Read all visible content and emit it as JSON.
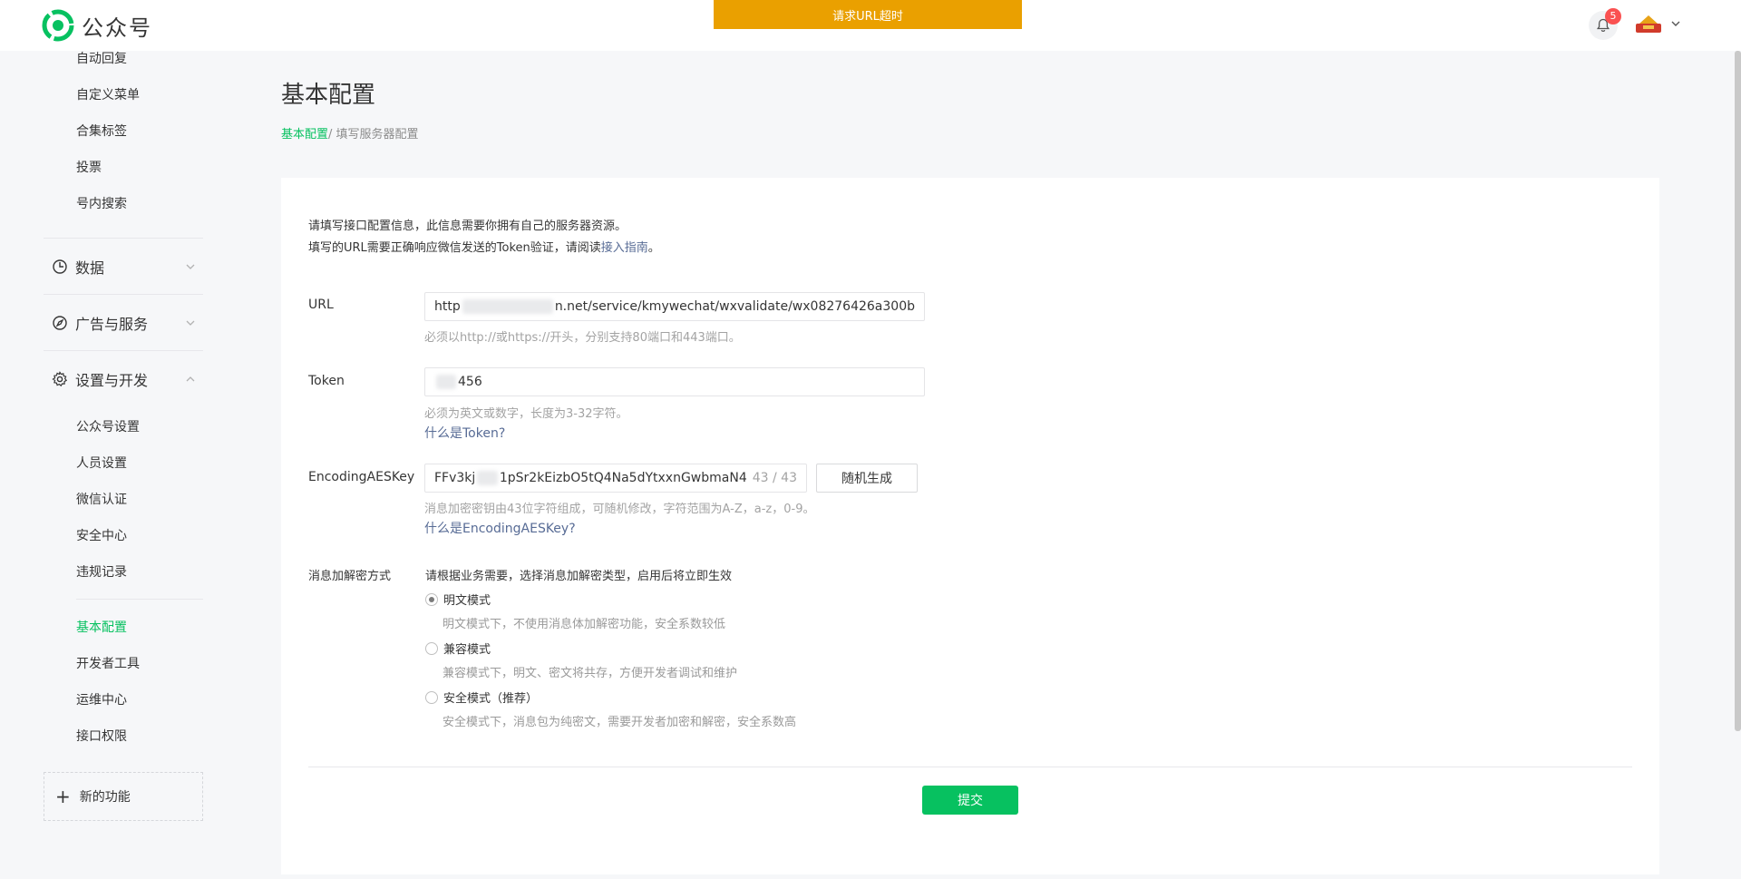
{
  "header": {
    "brand": "公众号",
    "toast": "请求URL超时",
    "notification_count": "5"
  },
  "sidebar": {
    "top_items": [
      {
        "label": "自动回复"
      },
      {
        "label": "自定义菜单"
      },
      {
        "label": "合集标签"
      },
      {
        "label": "投票"
      },
      {
        "label": "号内搜索"
      }
    ],
    "groups": [
      {
        "label": "数据",
        "icon": "chart-icon",
        "expanded": false
      },
      {
        "label": "广告与服务",
        "icon": "compass-icon",
        "expanded": false
      },
      {
        "label": "设置与开发",
        "icon": "gear-icon",
        "expanded": true
      }
    ],
    "settings_items": [
      {
        "label": "公众号设置"
      },
      {
        "label": "人员设置"
      },
      {
        "label": "微信认证"
      },
      {
        "label": "安全中心"
      },
      {
        "label": "违规记录"
      }
    ],
    "dev_items": [
      {
        "label": "基本配置",
        "active": true
      },
      {
        "label": "开发者工具"
      },
      {
        "label": "运维中心"
      },
      {
        "label": "接口权限"
      }
    ],
    "new_function": "新的功能"
  },
  "main": {
    "title": "基本配置",
    "breadcrumb": {
      "link": "基本配置",
      "sep": "/ ",
      "current": "填写服务器配置"
    },
    "intro_line1": "请填写接口配置信息，此信息需要你拥有自己的服务器资源。",
    "intro_line2_prefix": "填写的URL需要正确响应微信发送的Token验证，请阅读",
    "intro_line2_link": "接入指南",
    "intro_line2_suffix": "。",
    "url": {
      "label": "URL",
      "value_prefix": "http",
      "value_suffix": "n.net/service/kmywechat/wxvalidate/wx08276426a300b",
      "hint": "必须以http://或https://开头，分别支持80端口和443端口。"
    },
    "token": {
      "label": "Token",
      "value_suffix": "456",
      "hint": "必须为英文或数字，长度为3-32字符。",
      "help": "什么是Token?"
    },
    "aes": {
      "label": "EncodingAESKey",
      "value_prefix": "FFv3kj",
      "value_suffix": "1pSr2kEizbO5tQ4Na5dYtxxnGwbmaN4",
      "counter": "43 / 43",
      "random_button": "随机生成",
      "hint": "消息加密密钥由43位字符组成，可随机修改，字符范围为A-Z，a-z，0-9。",
      "help": "什么是EncodingAESKey?"
    },
    "encryption": {
      "label": "消息加解密方式",
      "intro": "请根据业务需要，选择消息加解密类型，启用后将立即生效",
      "options": [
        {
          "label": "明文模式",
          "desc": "明文模式下，不使用消息体加解密功能，安全系数较低",
          "checked": true
        },
        {
          "label": "兼容模式",
          "desc": "兼容模式下，明文、密文将共存，方便开发者调试和维护",
          "checked": false
        },
        {
          "label": "安全模式（推荐）",
          "desc": "安全模式下，消息包为纯密文，需要开发者加密和解密，安全系数高",
          "checked": false
        }
      ]
    },
    "submit": "提交"
  },
  "colors": {
    "accent": "#07c160",
    "link": "#576b95",
    "toast": "#eaa000",
    "badge": "#fa5151"
  }
}
